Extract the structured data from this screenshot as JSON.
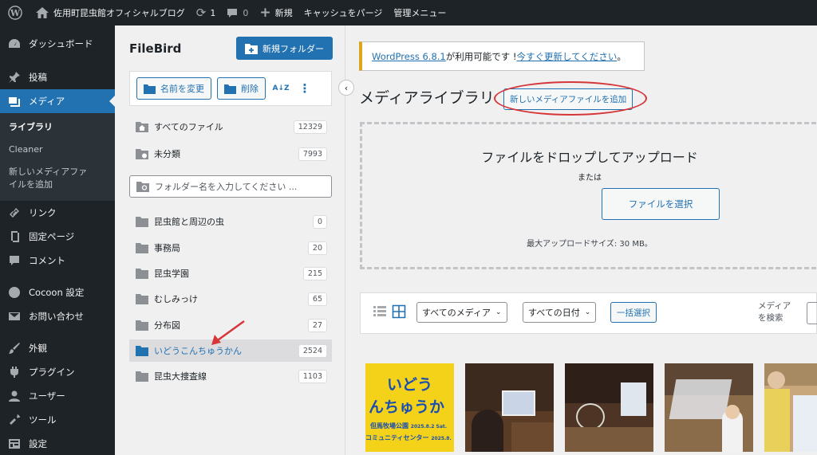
{
  "adminbar": {
    "site_name": "佐用町昆虫館オフィシャルブログ",
    "updates_count": "1",
    "comments_count": "0",
    "new_label": "新規",
    "purge_cache_label": "キャッシュをパージ",
    "admin_menu_label": "管理メニュー"
  },
  "sidebar": {
    "items": [
      {
        "label": "ダッシュボード",
        "icon": "dashboard-icon"
      },
      {
        "label": "投稿",
        "icon": "pin-icon"
      },
      {
        "label": "メディア",
        "icon": "media-icon"
      },
      {
        "label": "リンク",
        "icon": "link-icon"
      },
      {
        "label": "固定ページ",
        "icon": "page-icon"
      },
      {
        "label": "コメント",
        "icon": "comment-icon"
      },
      {
        "label": "Cocoon 設定",
        "icon": "circle-icon"
      },
      {
        "label": "お問い合わせ",
        "icon": "mail-icon"
      },
      {
        "label": "外観",
        "icon": "brush-icon"
      },
      {
        "label": "プラグイン",
        "icon": "plugin-icon"
      },
      {
        "label": "ユーザー",
        "icon": "user-icon"
      },
      {
        "label": "ツール",
        "icon": "wrench-icon"
      },
      {
        "label": "設定",
        "icon": "settings-icon"
      }
    ],
    "media_submenu": [
      "ライブラリ",
      "Cleaner",
      "新しいメディアファイルを追加"
    ]
  },
  "filebird": {
    "title": "FileBird",
    "new_folder_label": "新規フォルダー",
    "rename_label": "名前を変更",
    "delete_label": "削除",
    "sort_icon_text": "A↓Z",
    "more_icon_text": "⋮",
    "all_files": {
      "label": "すべてのファイル",
      "count": "12329"
    },
    "uncategorized": {
      "label": "未分類",
      "count": "7993"
    },
    "search_placeholder": "フォルダー名を入力してください ...",
    "folders": [
      {
        "label": "昆虫館と周辺の虫",
        "count": "0"
      },
      {
        "label": "事務局",
        "count": "20"
      },
      {
        "label": "昆虫学園",
        "count": "215"
      },
      {
        "label": "むしみっけ",
        "count": "65"
      },
      {
        "label": "分布図",
        "count": "27"
      },
      {
        "label": "いどうこんちゅうかん",
        "count": "2524"
      },
      {
        "label": "昆虫大捜査線",
        "count": "1103"
      }
    ]
  },
  "main": {
    "notice": {
      "version_link": "WordPress 6.8.1",
      "text": " が利用可能です ! ",
      "update_link": "今すぐ更新してください",
      "end": "。"
    },
    "page_title": "メディアライブラリ",
    "add_new_label": "新しいメディアファイルを追加",
    "drop_title": "ファイルをドロップしてアップロード",
    "drop_or": "または",
    "select_files_label": "ファイルを選択",
    "max_size": "最大アップロードサイズ: 30 MB。",
    "filter_media": "すべてのメディア",
    "filter_date": "すべての日付",
    "bulk_select": "一括選択",
    "search_label_line1": "メディア",
    "search_label_line2": "を検索",
    "poster": {
      "line1": "いどう",
      "line2": "んちゅうか",
      "line3": "但馬牧場公園",
      "line4": "2025.8.2 Sat.",
      "line5": "コミュニティセンター",
      "line6": "2025.8."
    }
  },
  "colors": {
    "adminbar_bg": "#1d2327",
    "accent": "#2271b1",
    "annotation_red": "#d63638",
    "notice_border": "#dba617"
  }
}
